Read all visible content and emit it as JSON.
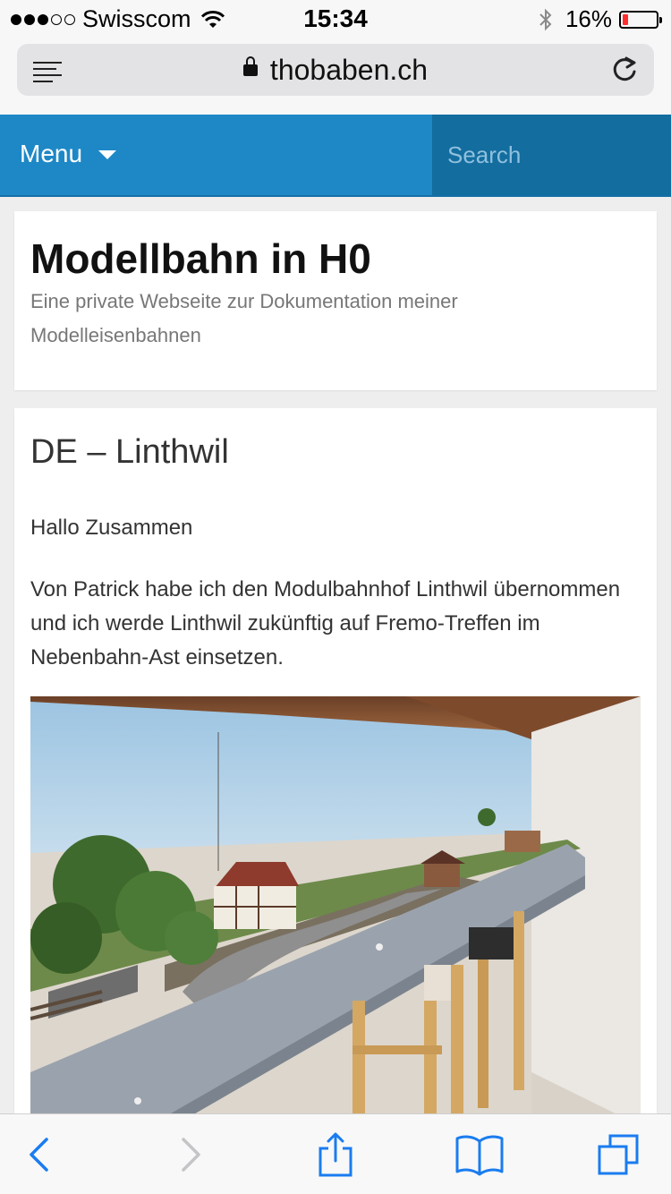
{
  "status_bar": {
    "carrier": "Swisscom",
    "signal_bars_filled": 3,
    "signal_bars_total": 5,
    "time": "15:34",
    "battery_percent": "16%"
  },
  "browser": {
    "url": "thobaben.ch"
  },
  "nav": {
    "menu_label": "Menu",
    "search_placeholder": "Search"
  },
  "site": {
    "title": "Modellbahn in H0",
    "description": "Eine private Webseite zur Dokumentation meiner Modelleisenbahnen"
  },
  "post": {
    "title": "DE – Linthwil",
    "greeting": "Hallo Zusammen",
    "body": "Von Patrick habe ich den Modulbahnhof Linthwil übernommen und ich werde Linthwil zukünftig auf Fremo-Treffen im Nebenbahn-Ast einsetzen."
  },
  "colors": {
    "nav_blue": "#1e88c7",
    "search_bg": "#136d9f",
    "ios_blue": "#1a7cf0",
    "battery_low": "#ff2d2d"
  },
  "toolbar": {
    "icons": [
      "back-icon",
      "forward-icon",
      "share-icon",
      "bookmarks-icon",
      "tabs-icon"
    ]
  }
}
